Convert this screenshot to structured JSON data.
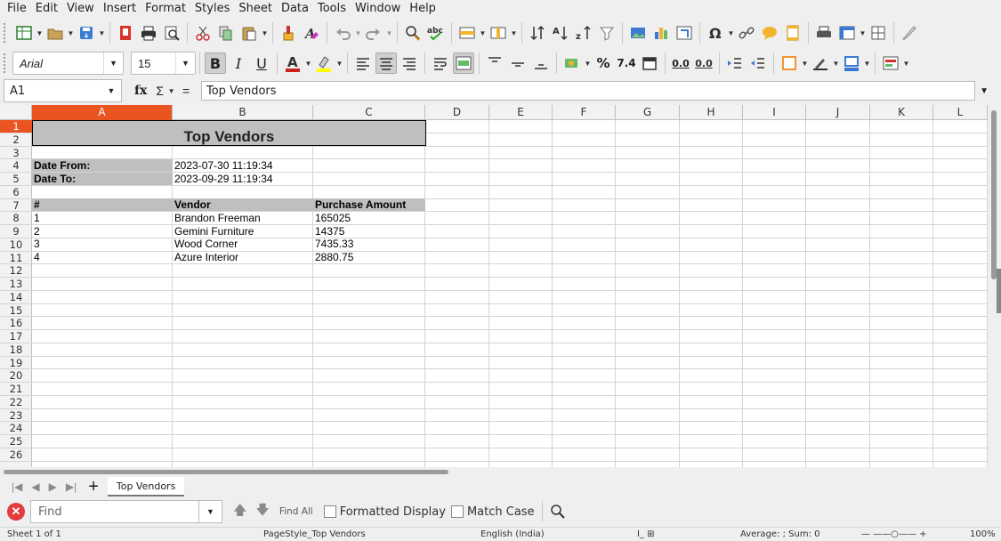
{
  "menu": [
    "File",
    "Edit",
    "View",
    "Insert",
    "Format",
    "Styles",
    "Sheet",
    "Data",
    "Tools",
    "Window",
    "Help"
  ],
  "toolbar2": {
    "font_name": "Arial",
    "font_size": "15",
    "bold": "B",
    "italic": "I",
    "underline": "U",
    "percent": "%",
    "number": "7.4",
    "add_decimal": "0.0",
    "del_decimal": "0.0"
  },
  "formula_bar": {
    "name_box": "A1",
    "fx": "fx",
    "sum": "Σ",
    "equals": "=",
    "content": "Top Vendors"
  },
  "columns": [
    "A",
    "B",
    "C",
    "D",
    "E",
    "F",
    "G",
    "H",
    "I",
    "J",
    "K",
    "L"
  ],
  "selected_column": "A",
  "rows": [
    "1",
    "2",
    "3",
    "4",
    "5",
    "6",
    "7",
    "8",
    "9",
    "10",
    "11",
    "12",
    "13",
    "14",
    "15",
    "16",
    "17",
    "18",
    "19",
    "20",
    "21",
    "22",
    "23",
    "24",
    "25",
    "26"
  ],
  "selected_row": "1",
  "sheet": {
    "title": "Top Vendors",
    "date_from_label": "Date From:",
    "date_from_value": "2023-07-30 11:19:34",
    "date_to_label": "Date To:",
    "date_to_value": "2023-09-29 11:19:34",
    "table_headers": [
      "#",
      "Vendor",
      "Purchase Amount"
    ],
    "table_rows": [
      [
        "1",
        "Brandon Freeman",
        "165025"
      ],
      [
        "2",
        "Gemini Furniture",
        "14375"
      ],
      [
        "3",
        "Wood Corner",
        "7435.33"
      ],
      [
        "4",
        "Azure Interior",
        "2880.75"
      ]
    ]
  },
  "tabs": {
    "sheet_tab": "Top Vendors"
  },
  "find_bar": {
    "placeholder": "Find",
    "find_all": "Find All",
    "formatted_display": "Formatted Display",
    "match_case": "Match Case"
  },
  "status_bar": {
    "sheet_pos": "Sheet 1 of 1",
    "page_style": "PageStyle_Top Vendors",
    "language": "English (India)",
    "stats": "Average: ; Sum: 0",
    "zoom": "100%"
  },
  "colors": {
    "selection": "#e95420",
    "header_fill": "#bfbfbf"
  }
}
